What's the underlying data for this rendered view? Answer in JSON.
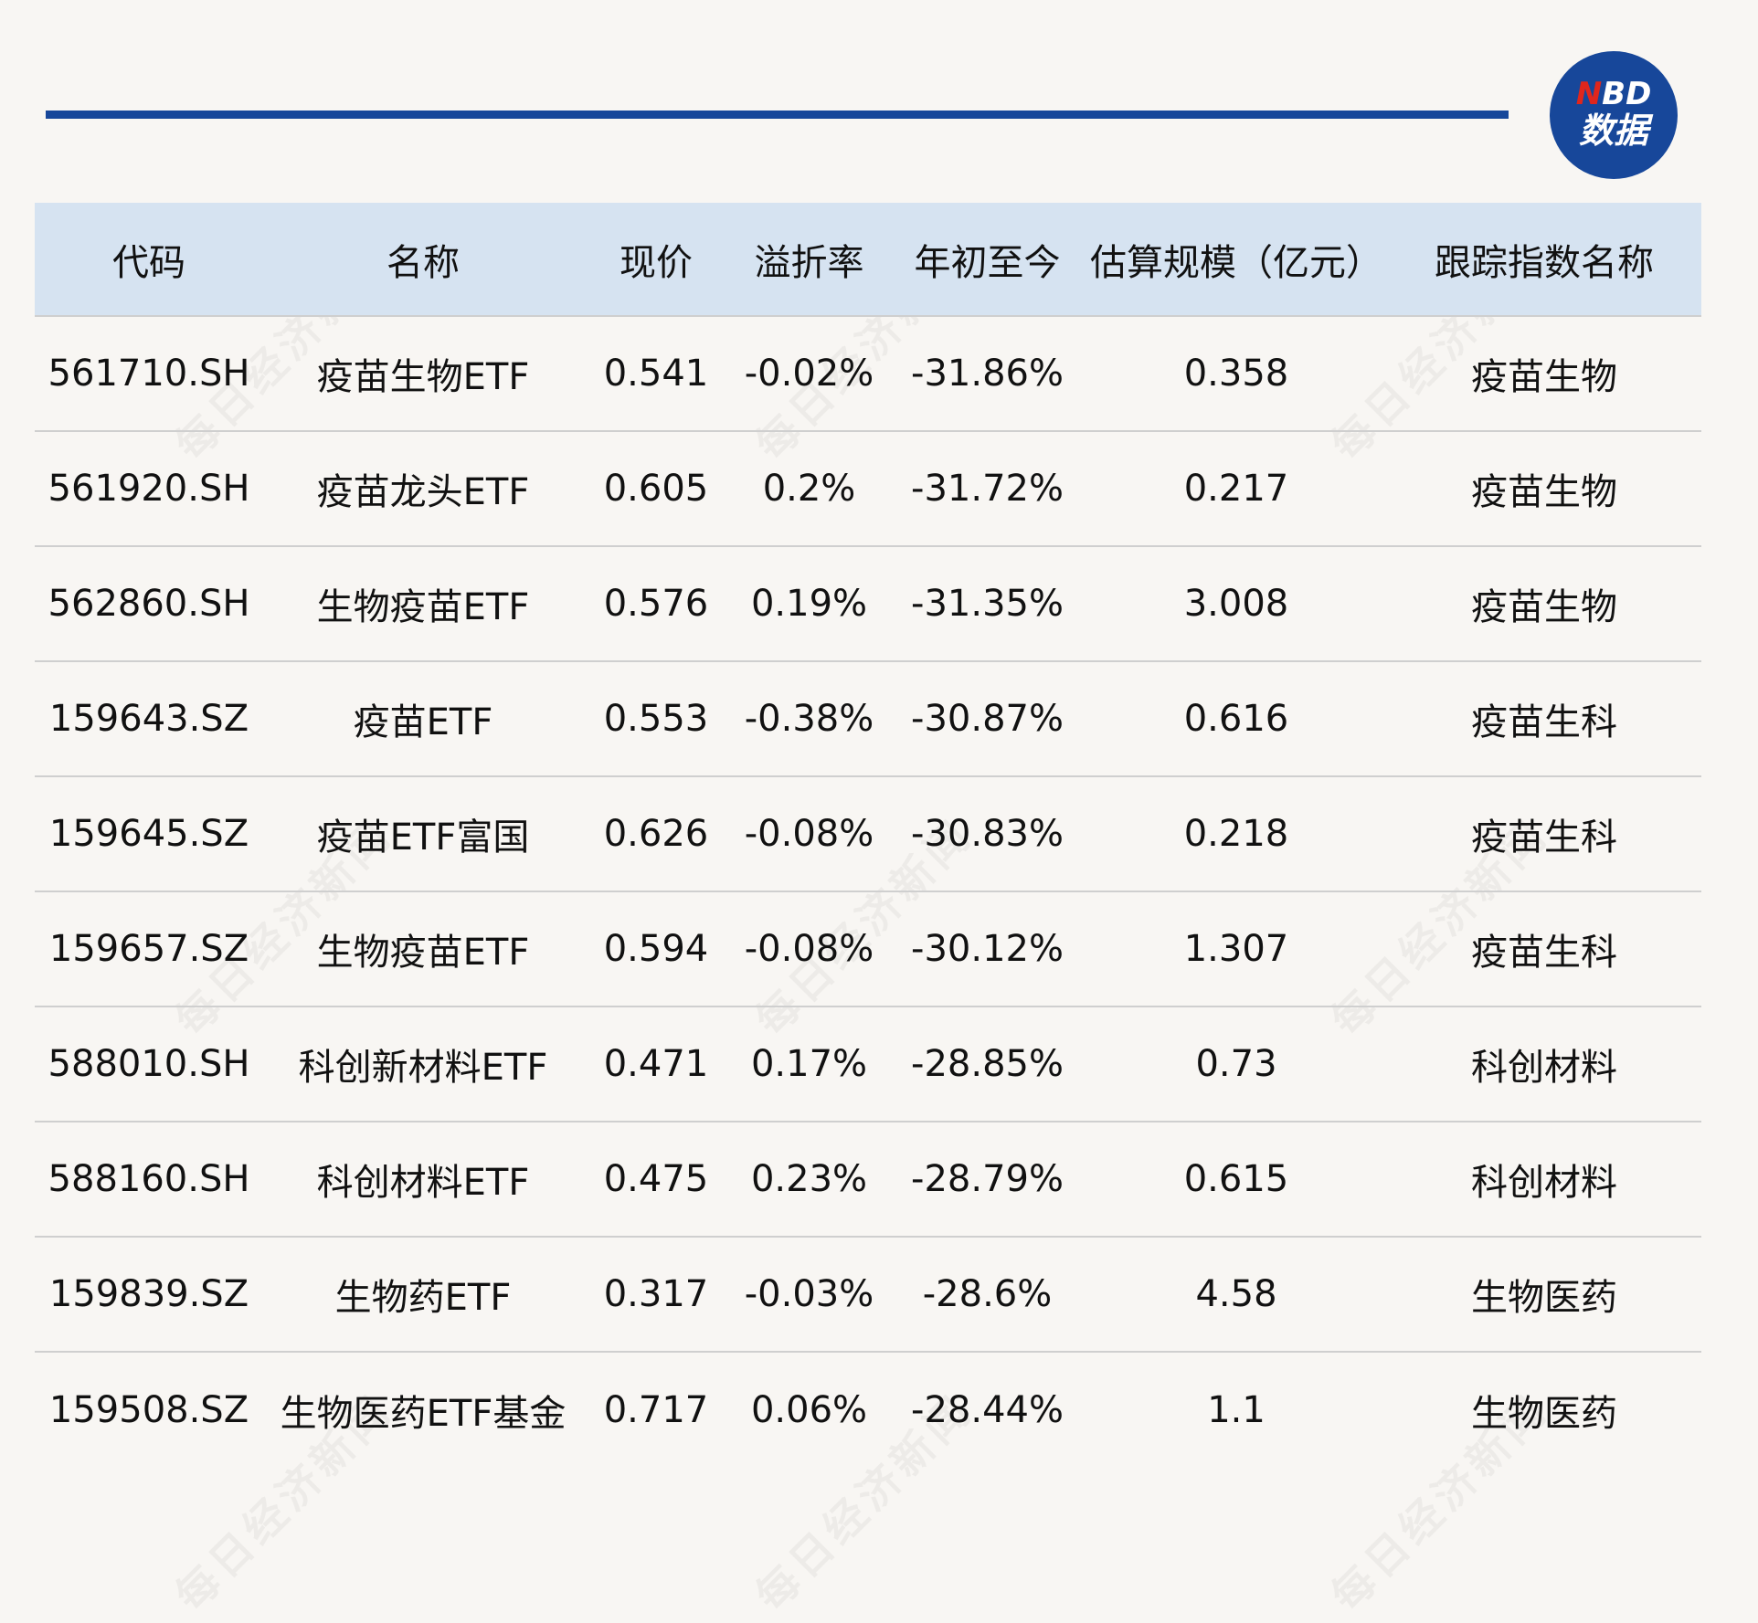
{
  "logo": {
    "line1_n": "N",
    "line1_rest": "BD",
    "line2": "数据"
  },
  "watermark_text": "每日经济新闻",
  "headers": [
    "代码",
    "名称",
    "现价",
    "溢折率",
    "年初至今",
    "估算规模（亿元）",
    "跟踪指数名称"
  ],
  "rows": [
    [
      "561710.SH",
      "疫苗生物ETF",
      "0.541",
      "-0.02%",
      "-31.86%",
      "0.358",
      "疫苗生物"
    ],
    [
      "561920.SH",
      "疫苗龙头ETF",
      "0.605",
      "0.2%",
      "-31.72%",
      "0.217",
      "疫苗生物"
    ],
    [
      "562860.SH",
      "生物疫苗ETF",
      "0.576",
      "0.19%",
      "-31.35%",
      "3.008",
      "疫苗生物"
    ],
    [
      "159643.SZ",
      "疫苗ETF",
      "0.553",
      "-0.38%",
      "-30.87%",
      "0.616",
      "疫苗生科"
    ],
    [
      "159645.SZ",
      "疫苗ETF富国",
      "0.626",
      "-0.08%",
      "-30.83%",
      "0.218",
      "疫苗生科"
    ],
    [
      "159657.SZ",
      "生物疫苗ETF",
      "0.594",
      "-0.08%",
      "-30.12%",
      "1.307",
      "疫苗生科"
    ],
    [
      "588010.SH",
      "科创新材料ETF",
      "0.471",
      "0.17%",
      "-28.85%",
      "0.73",
      "科创材料"
    ],
    [
      "588160.SH",
      "科创材料ETF",
      "0.475",
      "0.23%",
      "-28.79%",
      "0.615",
      "科创材料"
    ],
    [
      "159839.SZ",
      "生物药ETF",
      "0.317",
      "-0.03%",
      "-28.6%",
      "4.58",
      "生物医药"
    ],
    [
      "159508.SZ",
      "生物医药ETF基金",
      "0.717",
      "0.06%",
      "-28.44%",
      "1.1",
      "生物医药"
    ]
  ]
}
